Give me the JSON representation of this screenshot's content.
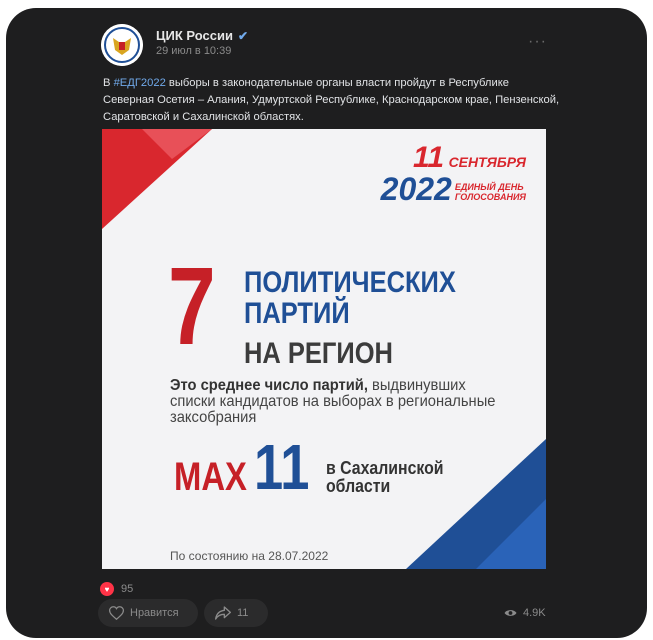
{
  "post": {
    "author": "ЦИК России",
    "verified_mark": "✔",
    "date": "29 июл в 10:39",
    "more_label": "···",
    "text_before": "В ",
    "hashtag": "#ЕДГ2022",
    "text_after": " выборы в законодательные органы власти пройдут в Республике Северная Осетия – Алания, Удмуртской Республике, Краснодарском крае, Пензенской, Саратовской и Сахалинской областях."
  },
  "image": {
    "date_day": "11",
    "date_month": "СЕНТЯБРЯ",
    "date_year": "2022",
    "date_sub1": "ЕДИНЫЙ ДЕНЬ",
    "date_sub2": "ГОЛОСОВАНИЯ",
    "big_number": "7",
    "headline_line1": "ПОЛИТИЧЕСКИХ",
    "headline_line2": "ПАРТИЙ",
    "headline_line3": "НА РЕГИОН",
    "desc_bold": "Это среднее число партий,",
    "desc_rest": " выдвинувших списки кандидатов на выборах в региональные заксобрания",
    "max_label": "MAX",
    "max_value": "11",
    "max_region_line1": "в Сахалинской",
    "max_region_line2": "области",
    "footnote": "По состоянию на 28.07.2022"
  },
  "footer": {
    "reactions_count": "95",
    "like_label": "Нравится",
    "share_count": "11",
    "views": "4.9K"
  },
  "colors": {
    "card_bg": "#1e1e1f",
    "accent_blue": "#71aaeb",
    "brand_red": "#c62027",
    "brand_blue": "#1f4f96"
  },
  "icons": [
    "emblem-avatar",
    "verified-icon",
    "more-icon",
    "heart-icon",
    "share-icon",
    "eye-icon"
  ]
}
